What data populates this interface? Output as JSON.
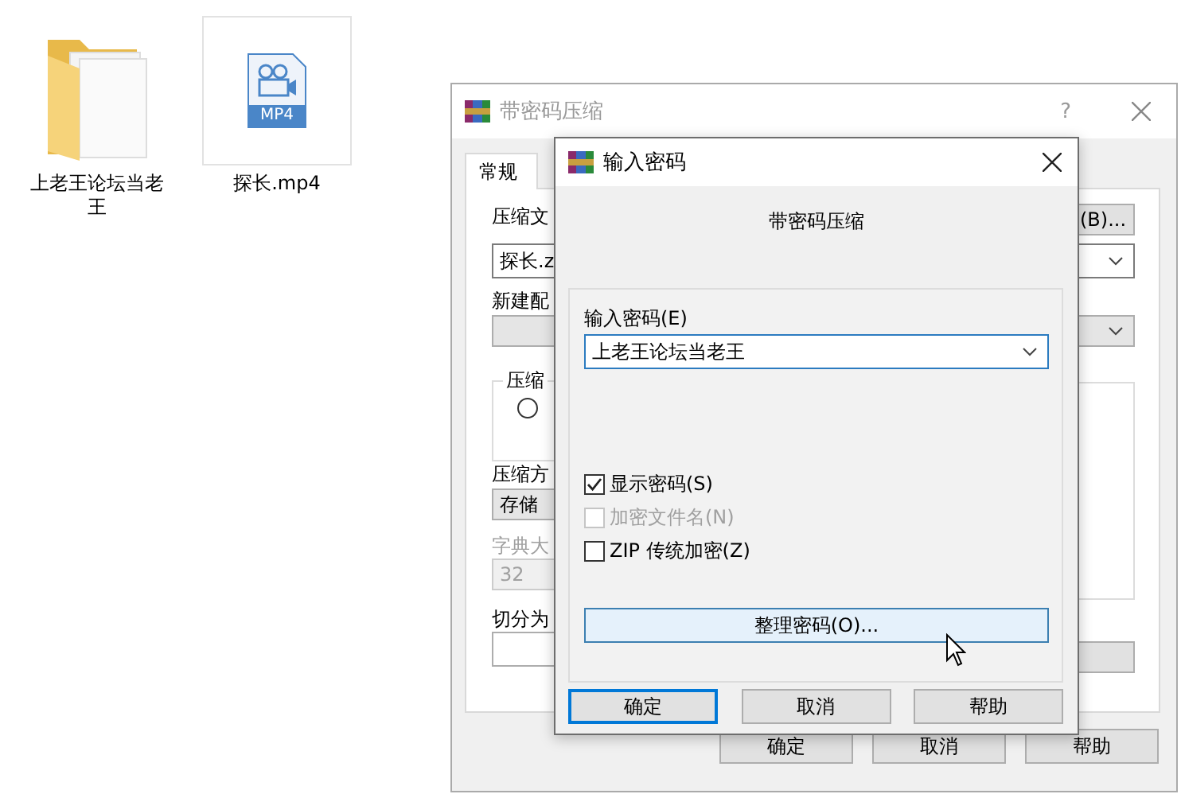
{
  "desktop_icons": [
    {
      "kind": "folder",
      "label": "上老王论坛当老王",
      "selected": false
    },
    {
      "kind": "video",
      "label": "探长.mp4",
      "badge": "MP4",
      "selected": true
    }
  ],
  "back_window": {
    "title": "带密码压缩",
    "help": "?",
    "tabs": [
      {
        "label": "常规",
        "selected": true
      }
    ],
    "archive_label": "压缩文",
    "browse_button": "(B)...",
    "archive_name": "探长.z",
    "profile_label": "新建配",
    "group_label": "压缩",
    "radio": {
      "selected": false
    },
    "method_label": "压缩方",
    "method_value": "存储",
    "dict_label": "字典大",
    "dict_disabled": true,
    "dict_value": "32",
    "split_label": "切分为",
    "buttons": [
      "确定",
      "取消",
      "帮助"
    ]
  },
  "dialog": {
    "title": "输入密码",
    "subtitle": "带密码压缩",
    "password_label": "输入密码(E)",
    "password": "上老王论坛当老王",
    "options": [
      {
        "label": "显示密码(S)",
        "checked": true,
        "disabled": false
      },
      {
        "label": "加密文件名(N)",
        "checked": false,
        "disabled": true
      },
      {
        "label": "ZIP 传统加密(Z)",
        "checked": false,
        "disabled": false
      }
    ],
    "organize_button": "整理密码(O)...",
    "buttons": [
      {
        "label": "确定",
        "focused": true
      },
      {
        "label": "取消",
        "focused": false
      },
      {
        "label": "帮助",
        "focused": false
      }
    ]
  }
}
